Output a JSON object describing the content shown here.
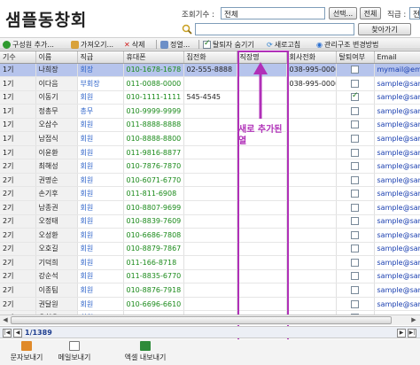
{
  "title": "샘플동창회",
  "filters": {
    "cohort_label": "조회기수 :",
    "cohort_value": "전체",
    "select_button": "선택...",
    "all_button": "전체",
    "position_label": "직급 :",
    "position_value": "전체"
  },
  "search": {
    "button": "찾아가기",
    "value": ""
  },
  "toolbar": {
    "compose": "구성원 추가...",
    "import": "가져오기...",
    "delete": "삭제",
    "info": "정열...",
    "hide_withdrawn": "탈퇴자 숨기기",
    "refresh": "새로고침",
    "change_structure": "관리구조 변경방법"
  },
  "grid": {
    "columns": [
      "기수",
      "이름",
      "직급",
      "휴대폰",
      "집전화",
      "직장명",
      "회사전화",
      "탈퇴여부",
      "Email"
    ],
    "rows": [
      {
        "cohort": "1기",
        "name": "나희장",
        "position": "회장",
        "mobile": "010-1678-1678",
        "home": "02-555-8888",
        "company": "",
        "office": "038-995-0000",
        "checked": false,
        "email": "mymail@ema",
        "selected": true
      },
      {
        "cohort": "1기",
        "name": "이다음",
        "position": "부회장",
        "mobile": "011-0088-0000",
        "home": "",
        "company": "",
        "office": "038-995-0000",
        "checked": false,
        "email": "sample@sam",
        "selected": false
      },
      {
        "cohort": "1기",
        "name": "이동기",
        "position": "회원",
        "mobile": "010-1111-1111",
        "home": "545-4545",
        "company": "",
        "office": "",
        "checked": true,
        "email": "sample@sam",
        "selected": false
      },
      {
        "cohort": "1기",
        "name": "정총무",
        "position": "총무",
        "mobile": "010-9999-9999",
        "home": "",
        "company": "",
        "office": "",
        "checked": false,
        "email": "sample@sam",
        "selected": false
      },
      {
        "cohort": "1기",
        "name": "오삼수",
        "position": "회원",
        "mobile": "011-8888-8888",
        "home": "",
        "company": "",
        "office": "",
        "checked": false,
        "email": "sample@sam",
        "selected": false
      },
      {
        "cohort": "1기",
        "name": "남접식",
        "position": "회원",
        "mobile": "010-8888-8800",
        "home": "",
        "company": "",
        "office": "",
        "checked": false,
        "email": "sample@sam",
        "selected": false
      },
      {
        "cohort": "1기",
        "name": "이윤환",
        "position": "회원",
        "mobile": "011-9816-8877",
        "home": "",
        "company": "",
        "office": "",
        "checked": false,
        "email": "sample@sam",
        "selected": false
      },
      {
        "cohort": "2기",
        "name": "최해성",
        "position": "회원",
        "mobile": "010-7876-7870",
        "home": "",
        "company": "",
        "office": "",
        "checked": false,
        "email": "sample@sam",
        "selected": false
      },
      {
        "cohort": "2기",
        "name": "권명순",
        "position": "회원",
        "mobile": "010-6071-6770",
        "home": "",
        "company": "",
        "office": "",
        "checked": false,
        "email": "sample@sam",
        "selected": false
      },
      {
        "cohort": "2기",
        "name": "손기후",
        "position": "회원",
        "mobile": "011-811-6908",
        "home": "",
        "company": "",
        "office": "",
        "checked": false,
        "email": "sample@sam",
        "selected": false
      },
      {
        "cohort": "2기",
        "name": "남종권",
        "position": "회원",
        "mobile": "010-8807-9699",
        "home": "",
        "company": "",
        "office": "",
        "checked": false,
        "email": "sample@sam",
        "selected": false
      },
      {
        "cohort": "2기",
        "name": "오정태",
        "position": "회원",
        "mobile": "010-8839-7609",
        "home": "",
        "company": "",
        "office": "",
        "checked": false,
        "email": "sample@sam",
        "selected": false
      },
      {
        "cohort": "2기",
        "name": "오성환",
        "position": "회원",
        "mobile": "010-6686-7808",
        "home": "",
        "company": "",
        "office": "",
        "checked": false,
        "email": "sample@sam",
        "selected": false
      },
      {
        "cohort": "2기",
        "name": "오호길",
        "position": "회원",
        "mobile": "010-8879-7867",
        "home": "",
        "company": "",
        "office": "",
        "checked": false,
        "email": "sample@sam",
        "selected": false
      },
      {
        "cohort": "2기",
        "name": "기덕희",
        "position": "회원",
        "mobile": "011-166-8718",
        "home": "",
        "company": "",
        "office": "",
        "checked": false,
        "email": "sample@sam",
        "selected": false
      },
      {
        "cohort": "2기",
        "name": "강순석",
        "position": "회원",
        "mobile": "011-8835-6770",
        "home": "",
        "company": "",
        "office": "",
        "checked": false,
        "email": "sample@sam",
        "selected": false
      },
      {
        "cohort": "2기",
        "name": "이종팀",
        "position": "회원",
        "mobile": "010-8876-7918",
        "home": "",
        "company": "",
        "office": "",
        "checked": false,
        "email": "sample@sam",
        "selected": false
      },
      {
        "cohort": "2기",
        "name": "권달원",
        "position": "회원",
        "mobile": "010-6696-6610",
        "home": "",
        "company": "",
        "office": "",
        "checked": false,
        "email": "sample@sam",
        "selected": false
      },
      {
        "cohort": "2기",
        "name": "오칠용",
        "position": "회원",
        "mobile": "017-761-1787",
        "home": "",
        "company": "",
        "office": "",
        "checked": false,
        "email": "sample@sam",
        "selected": false
      },
      {
        "cohort": "2기",
        "name": "오종진",
        "position": "회원",
        "mobile": "010-6160-7677",
        "home": "",
        "company": "",
        "office": "",
        "checked": false,
        "email": "sample@sam",
        "selected": false
      }
    ]
  },
  "annotation": "새로 추가된 열",
  "pager": {
    "text": "1/1389"
  },
  "footer": {
    "sms": "문자보내기",
    "mail": "메일보내기",
    "excel": "엑셀 내보내기"
  },
  "colors": {
    "highlight": "#b030b8",
    "selected_row": "#b6c4ec",
    "position_text": "#2d63c9",
    "phone_text": "#1a8a1a"
  }
}
